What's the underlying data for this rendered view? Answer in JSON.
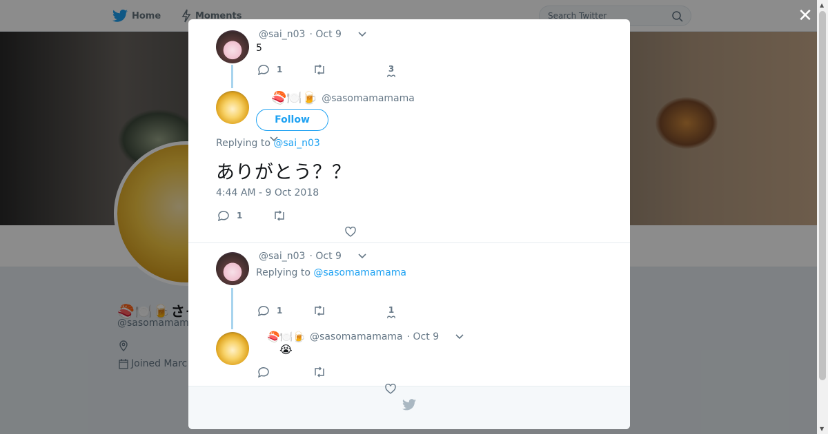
{
  "topbar": {
    "home_label": "Home",
    "moments_label": "Moments",
    "search_placeholder": "Search Twitter"
  },
  "profile": {
    "display_name": "🍣🍽️🍺さそまま",
    "handle": "@sasomamam",
    "joined": "Joined Marc"
  },
  "close_glyph": "✕",
  "colors": {
    "accent": "#1da1f2",
    "thread_line": "#a8d4ee",
    "muted": "#657786"
  },
  "tweets": [
    {
      "handle": "@sai_n03",
      "date": "· Oct 9",
      "text": "5",
      "reply_count": "1",
      "like_count": "3"
    },
    {
      "emoji": "🍣🍽️🍺",
      "handle": "@sasomamamama",
      "follow_label": "Follow",
      "replying_prefix": "Replying to",
      "replying_to": "@sai_n03",
      "text": "ありがとう？？",
      "timestamp": "4:44 AM - 9 Oct 2018",
      "reply_count": "1"
    },
    {
      "handle": "@sai_n03",
      "date": "· Oct 9",
      "replying_prefix": "Replying to",
      "replying_to": "@sasomamamama",
      "reply_count": "1",
      "like_count": "1"
    },
    {
      "emoji": "🍣🍽️🍺",
      "handle": "@sasomamamama",
      "date": "· Oct 9",
      "text": "😭"
    }
  ]
}
